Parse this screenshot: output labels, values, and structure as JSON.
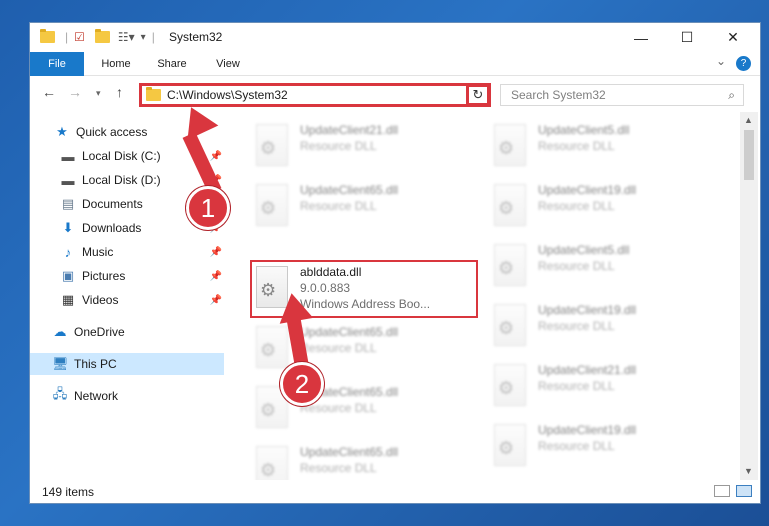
{
  "window": {
    "title": "System32",
    "controls": {
      "minimize": "—",
      "maximize": "☐",
      "close": "✕"
    }
  },
  "ribbon": {
    "tabs": [
      {
        "label": "File"
      },
      {
        "label": "Home"
      },
      {
        "label": "Share"
      },
      {
        "label": "View"
      }
    ],
    "help": "?",
    "collapse": "⌄"
  },
  "address": {
    "path": "C:\\Windows\\System32",
    "search_placeholder": "Search System32"
  },
  "nav": {
    "items": [
      {
        "label": "Quick access",
        "icon": "star-icon"
      },
      {
        "label": "Local Disk (C:)",
        "icon": "drive-icon"
      },
      {
        "label": "Local Disk (D:)",
        "icon": "drive-icon"
      },
      {
        "label": "Documents",
        "icon": "documents-icon"
      },
      {
        "label": "Downloads",
        "icon": "download-icon"
      },
      {
        "label": "Music",
        "icon": "music-icon"
      },
      {
        "label": "Pictures",
        "icon": "pictures-icon"
      },
      {
        "label": "Videos",
        "icon": "videos-icon"
      },
      {
        "label": "OneDrive",
        "icon": "cloud-icon"
      },
      {
        "label": "This PC",
        "icon": "computer-icon"
      },
      {
        "label": "Network",
        "icon": "network-icon"
      }
    ]
  },
  "files": [
    {
      "name": "UpdateClient21.dll",
      "sub": "Resource DLL"
    },
    {
      "name": "UpdateClient5.dll",
      "sub": "Resource DLL"
    },
    {
      "name": "UpdateClient65.dll",
      "sub": "Resource DLL"
    },
    {
      "name": "UpdateClient19.dll",
      "sub": "Resource DLL"
    },
    {
      "name": "ablddata.dll",
      "sub": "9.0.0.883",
      "sub2": "Windows Address Boo..."
    },
    {
      "name": "UpdateClient5.dll",
      "sub": "Resource DLL"
    },
    {
      "name": "UpdateClient65.dll",
      "sub": "Resource DLL"
    },
    {
      "name": "UpdateClient19.dll",
      "sub": "Resource DLL"
    },
    {
      "name": "UpdateClient65.dll",
      "sub": "Resource DLL"
    },
    {
      "name": "UpdateClient21.dll",
      "sub": "Resource DLL"
    },
    {
      "name": "UpdateClient65.dll",
      "sub": "Resource DLL"
    },
    {
      "name": "UpdateClient19.dll",
      "sub": "Resource DLL"
    }
  ],
  "status": {
    "count": "149 items"
  },
  "annotations": {
    "badge1": "1",
    "badge2": "2"
  },
  "colors": {
    "accent": "#1979ca",
    "highlight": "#d9363e",
    "selection": "#cce8ff"
  }
}
